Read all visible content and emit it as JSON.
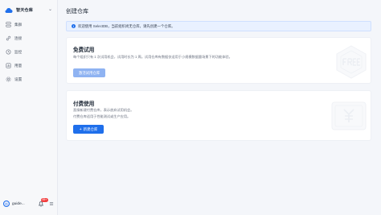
{
  "sidebar": {
    "brand": "智天仓库",
    "items": [
      {
        "label": "集群",
        "icon": "cluster-icon"
      },
      {
        "label": "连接",
        "icon": "link-icon"
      },
      {
        "label": "监控",
        "icon": "monitor-icon"
      },
      {
        "label": "用量",
        "icon": "usage-icon"
      },
      {
        "label": "设置",
        "icon": "settings-icon"
      }
    ],
    "user": {
      "avatar_letter": "G",
      "name": "guide...",
      "badge": "99+"
    }
  },
  "main": {
    "title": "创建仓库",
    "notice": "欢迎使用 SelectDB，当前组织尚无仓库，请先创建一个仓库。",
    "free_card": {
      "title": "免费试用",
      "desc": "每个组织只有 1 次试用机会，试用时长为 1 周。试用仓库有数据仅适用于小规模数据量场景下的功能体验。",
      "button": "激活试用仓库"
    },
    "paid_card": {
      "title": "付费使用",
      "desc1": "直接新建付费仓库，表示放弃试用机会。",
      "desc2": "付费仓库适用于性能测试或生产应用。",
      "button": "新建仓库"
    }
  },
  "colors": {
    "accent": "#1f6feb",
    "disabled": "#8fb3f2",
    "notice_bg": "#e9f1ff",
    "badge": "#f23c3c"
  }
}
